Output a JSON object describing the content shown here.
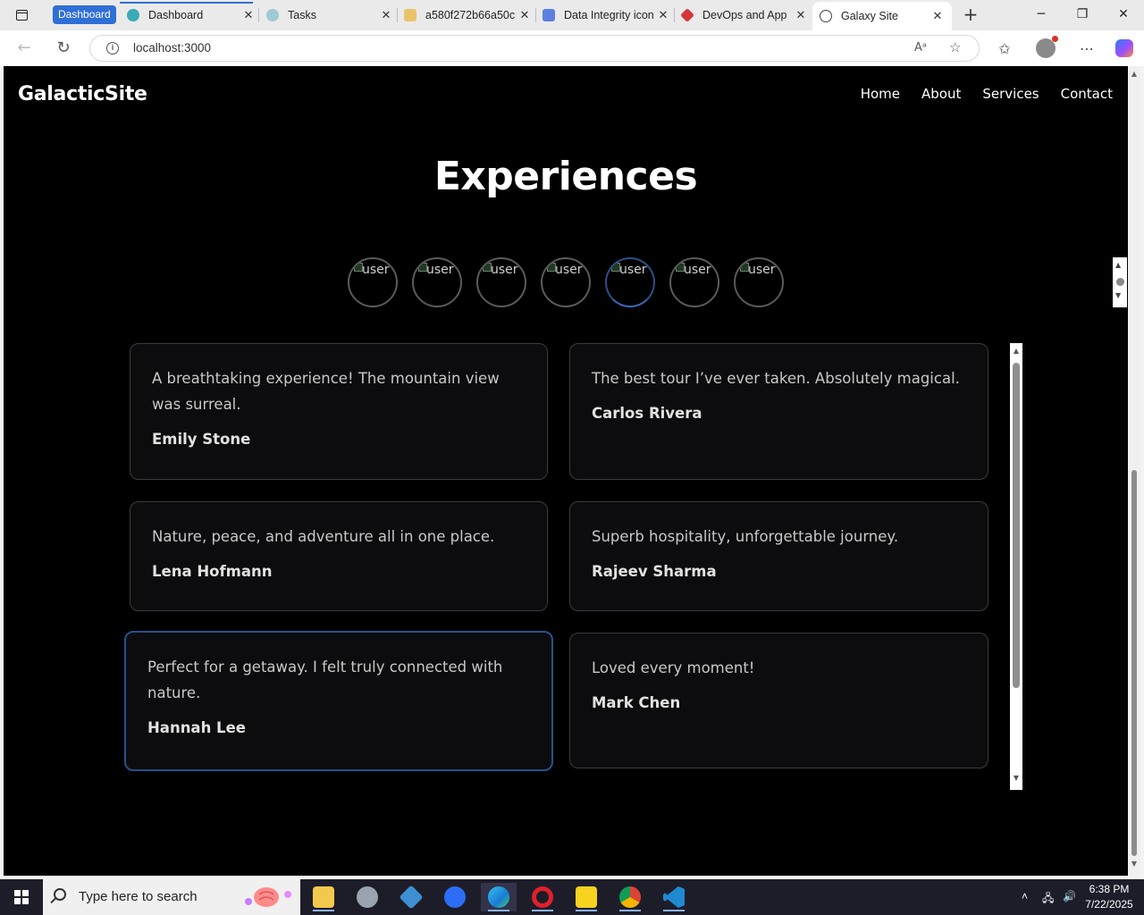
{
  "browser": {
    "tab_group_label": "Dashboard",
    "tabs": [
      {
        "title": "Dashboard",
        "icon": "dashboard-favicon",
        "color": "#3aa9b8"
      },
      {
        "title": "Tasks",
        "icon": "tasks-favicon",
        "color": "#7ab6c8"
      },
      {
        "title": "a580f272b66a50c",
        "icon": "w-favicon",
        "color": "#e9c46a"
      },
      {
        "title": "Data Integrity icon",
        "icon": "doc-favicon",
        "color": "#5b7fe0"
      },
      {
        "title": "DevOps and App",
        "icon": "devops-favicon",
        "color": "#d6343b"
      },
      {
        "title": "Galaxy Site",
        "icon": "globe-icon",
        "color": "#444444"
      }
    ],
    "url": "localhost:3000"
  },
  "site": {
    "logo": "GalacticSite",
    "nav": [
      "Home",
      "About",
      "Services",
      "Contact"
    ],
    "heading": "Experiences",
    "avatar_alt": "user",
    "avatar_count": 7,
    "active_avatar_index": 4,
    "testimonials": [
      {
        "quote": "A breathtaking experience! The mountain view was surreal.",
        "author": "Emily Stone"
      },
      {
        "quote": "The best tour I’ve ever taken. Absolutely magical.",
        "author": "Carlos Rivera"
      },
      {
        "quote": "Nature, peace, and adventure all in one place.",
        "author": "Lena Hofmann"
      },
      {
        "quote": "Superb hospitality, unforgettable journey.",
        "author": "Rajeev Sharma"
      },
      {
        "quote": "Perfect for a getaway. I felt truly connected with nature.",
        "author": "Hannah Lee"
      },
      {
        "quote": "Loved every moment!",
        "author": "Mark Chen"
      }
    ],
    "active_testimonial_index": 4,
    "accent_color": "#24528c",
    "background_color": "#000000"
  },
  "taskbar": {
    "search_placeholder": "Type here to search",
    "time": "6:38 PM",
    "date": "7/22/2025"
  }
}
